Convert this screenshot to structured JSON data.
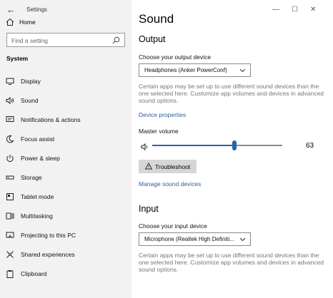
{
  "window": {
    "app_title": "Settings",
    "back_glyph": "←",
    "minimize_glyph": "—",
    "maximize_glyph": "☐",
    "close_glyph": "✕"
  },
  "sidebar": {
    "home_label": "Home",
    "search_placeholder": "Find a setting",
    "section_label": "System",
    "items": [
      {
        "label": "Display",
        "icon": "display-icon"
      },
      {
        "label": "Sound",
        "icon": "speaker-icon"
      },
      {
        "label": "Notifications & actions",
        "icon": "notifications-icon"
      },
      {
        "label": "Focus assist",
        "icon": "moon-icon"
      },
      {
        "label": "Power & sleep",
        "icon": "power-icon"
      },
      {
        "label": "Storage",
        "icon": "storage-icon"
      },
      {
        "label": "Tablet mode",
        "icon": "tablet-icon"
      },
      {
        "label": "Multitasking",
        "icon": "multitasking-icon"
      },
      {
        "label": "Projecting to this PC",
        "icon": "projecting-icon"
      },
      {
        "label": "Shared experiences",
        "icon": "shared-icon"
      },
      {
        "label": "Clipboard",
        "icon": "clipboard-icon"
      }
    ]
  },
  "main": {
    "title": "Sound",
    "output": {
      "heading": "Output",
      "device_label": "Choose your output device",
      "device_value": "Headphones (Anker PowerConf)",
      "description": "Certain apps may be set up to use different sound devices than the one selected here. Customize app volumes and devices in advanced sound options.",
      "properties_link": "Device properties",
      "volume_label": "Master volume",
      "volume_value": "63",
      "volume_level": 63,
      "troubleshoot_label": "Troubleshoot",
      "manage_link": "Manage sound devices"
    },
    "input": {
      "heading": "Input",
      "device_label": "Choose your input device",
      "device_value": "Microphone (Realtek High Definiti...",
      "description": "Certain apps may be set up to use different sound devices than the one selected here. Customize app volumes and devices in advanced sound options."
    }
  },
  "colors": {
    "accent": "#2a63a8",
    "link": "#2e5f9e",
    "sidebar_bg": "#f2f2f2"
  }
}
